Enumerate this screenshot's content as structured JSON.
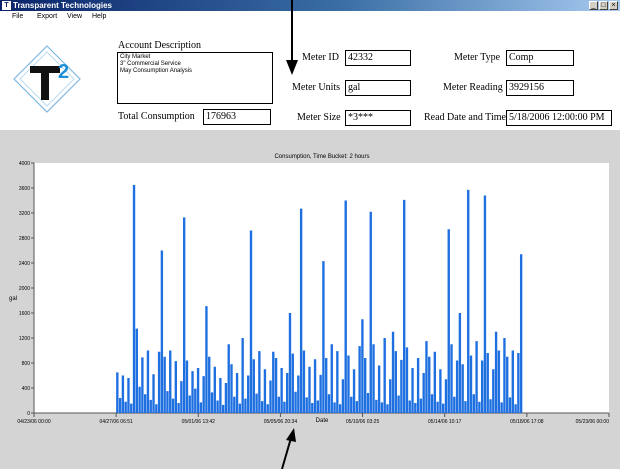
{
  "window": {
    "title": "Transparent Technologies",
    "icon_label": "T",
    "controls": [
      "_",
      "□",
      "×"
    ]
  },
  "menu": {
    "items": [
      "File",
      "Export",
      "View",
      "Help"
    ]
  },
  "form": {
    "account_description_label": "Account Description",
    "account_description_lines": [
      "City Market",
      "3\" Commercial Service",
      "May Consumption Analysis"
    ],
    "total_consumption_label": "Total Consumption",
    "total_consumption_value": "176963",
    "meter_id_label": "Meter ID",
    "meter_id_value": "42332",
    "meter_units_label": "Meter Units",
    "meter_units_value": "gal",
    "meter_size_label": "Meter Size",
    "meter_size_value": "*3***",
    "meter_type_label": "Meter Type",
    "meter_type_value": "Comp",
    "meter_reading_label": "Meter Reading",
    "meter_reading_value": "3929156",
    "read_date_label": "Read Date and Time",
    "read_date_value": "5/18/2006 12:00:00 PM"
  },
  "logo": {
    "text": "T",
    "superscript": "2"
  },
  "colors": {
    "title_bar": "#0a246a",
    "bar": "#1e6fe0",
    "panel": "#d4d4d4",
    "logo_blue": "#1e90d6"
  },
  "chart_data": {
    "type": "bar",
    "title": "Consumption, Time Bucket: 2 hours",
    "xlabel": "Date",
    "ylabel": "gal",
    "ylim": [
      0,
      4000
    ],
    "yticks": [
      0,
      400,
      800,
      1200,
      1600,
      2000,
      2400,
      2800,
      3200,
      3600,
      4000
    ],
    "xticks": [
      "04/23/06 00:00",
      "04/27/06 06:51",
      "05/01/06 13:42",
      "05/05/06 20:34",
      "05/10/06 03:25",
      "05/14/06 10:17",
      "05/18/06 17:08",
      "05/23/06 00:00"
    ],
    "grid": false,
    "series": [
      {
        "values": [
          650,
          240,
          600,
          180,
          560,
          150,
          3650,
          1350,
          420,
          890,
          300,
          1000,
          210,
          620,
          140,
          980,
          2600,
          900,
          350,
          1000,
          230,
          830,
          160,
          510,
          3130,
          840,
          280,
          670,
          390,
          720,
          170,
          590,
          1710,
          900,
          330,
          740,
          200,
          560,
          130,
          480,
          1100,
          780,
          260,
          640,
          150,
          1200,
          230,
          600,
          2920,
          860,
          310,
          990,
          190,
          700,
          140,
          520,
          980,
          880,
          260,
          720,
          180,
          640,
          1600,
          950,
          340,
          600,
          3270,
          1000,
          250,
          740,
          160,
          860,
          200,
          610,
          2430,
          880,
          300,
          1100,
          170,
          990,
          140,
          540,
          3400,
          920,
          260,
          700,
          190,
          1070,
          1500,
          880,
          320,
          3220,
          1100,
          210,
          760,
          170,
          1200,
          140,
          540,
          1300,
          990,
          280,
          850,
          3410,
          1050,
          200,
          720,
          160,
          880,
          230,
          640,
          1150,
          900,
          300,
          980,
          180,
          700,
          150,
          540,
          2940,
          1100,
          260,
          840,
          1600,
          780,
          190,
          3570,
          920,
          300,
          1150,
          180,
          840,
          3480,
          960,
          220,
          700,
          1300,
          1000,
          170,
          1200,
          900,
          250,
          1000,
          140,
          960,
          2540
        ]
      }
    ],
    "x_start": "04/23/06 00:00",
    "x_end": "05/23/06 00:00",
    "data_start": "04/27/06 06:51",
    "data_end": "05/18/06 12:00"
  }
}
